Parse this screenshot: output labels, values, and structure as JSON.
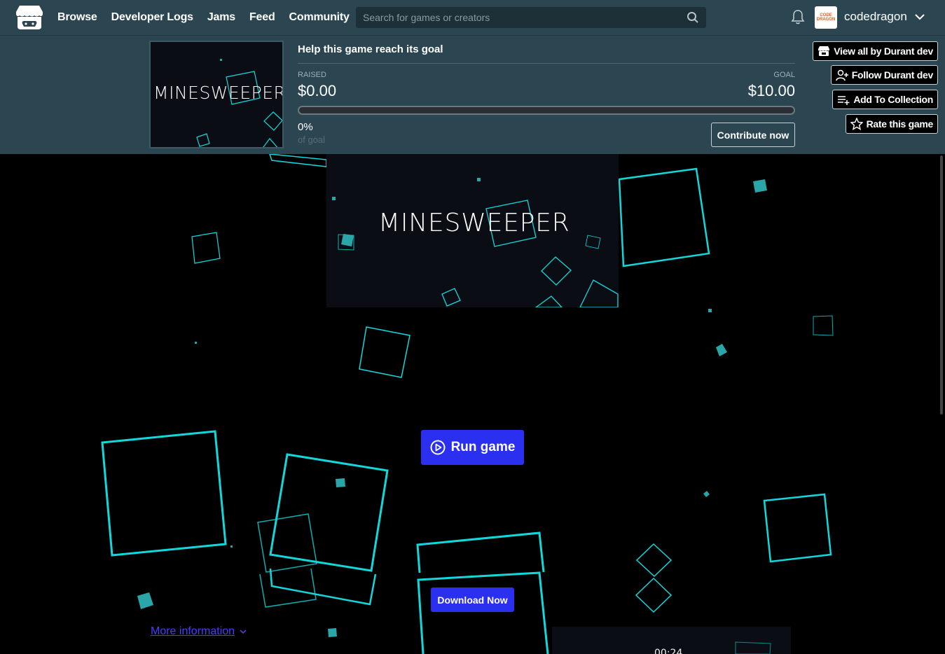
{
  "nav": {
    "links": [
      "Browse",
      "Developer Logs",
      "Jams",
      "Feed",
      "Community"
    ],
    "search_placeholder": "Search for games or creators",
    "username": "codedragon",
    "avatar_text": "CODE DRAGON"
  },
  "goal": {
    "heading": "Help this game reach its goal",
    "raised_label": "RAISED",
    "raised_value": "$0.00",
    "goal_label": "GOAL",
    "goal_value": "$10.00",
    "progress_percent": 0,
    "percent_text": "0%",
    "of_goal_text": "of goal",
    "contribute_label": "Contribute now"
  },
  "side_actions": {
    "view_all": "View all by Durant dev",
    "follow": "Follow Durant dev",
    "add_collection": "Add To Collection",
    "rate": "Rate this game"
  },
  "game": {
    "thumb_title": "MINESWEEPER",
    "cover_title": "MINESWEEPER",
    "run_label": "Run game",
    "download_label": "Download Now",
    "more_info_label": "More information",
    "video_time": "00:24"
  },
  "colors": {
    "header_bg": "#2b4651",
    "accent_button": "#2a2ff0",
    "square_stroke": "#1de6e6",
    "square_fill": "#2aa5a8"
  }
}
